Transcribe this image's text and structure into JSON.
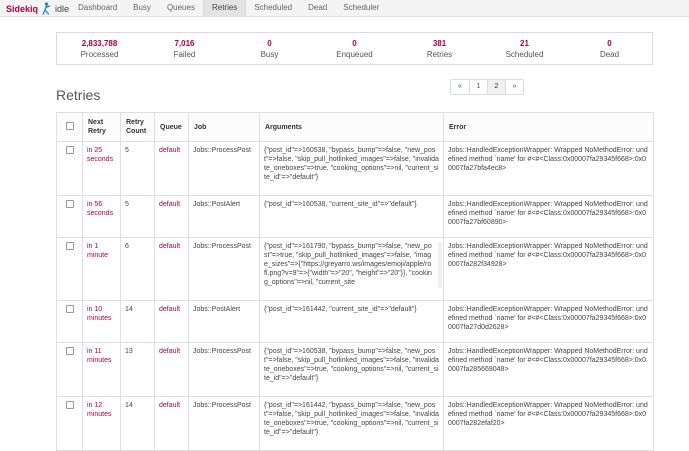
{
  "brand": {
    "name": "Sidekiq",
    "status": "idle"
  },
  "nav": [
    {
      "label": "Dashboard",
      "active": false
    },
    {
      "label": "Busy",
      "active": false
    },
    {
      "label": "Queues",
      "active": false
    },
    {
      "label": "Retries",
      "active": true
    },
    {
      "label": "Scheduled",
      "active": false
    },
    {
      "label": "Dead",
      "active": false
    },
    {
      "label": "Scheduler",
      "active": false
    }
  ],
  "stats": [
    {
      "value": "2,833,788",
      "label": "Processed"
    },
    {
      "value": "7,016",
      "label": "Failed"
    },
    {
      "value": "0",
      "label": "Busy"
    },
    {
      "value": "0",
      "label": "Enqueued"
    },
    {
      "value": "381",
      "label": "Retries"
    },
    {
      "value": "21",
      "label": "Scheduled"
    },
    {
      "value": "0",
      "label": "Dead"
    }
  ],
  "page_title": "Retries",
  "pagination": {
    "prev": "«",
    "pages": [
      "1",
      "2"
    ],
    "next": "»",
    "current": "2"
  },
  "table": {
    "headers": {
      "next_retry": "Next Retry",
      "retry_count": "Retry Count",
      "queue": "Queue",
      "job": "Job",
      "arguments": "Arguments",
      "error": "Error"
    },
    "rows": [
      {
        "when": "in 25 seconds",
        "count": "5",
        "queue": "default",
        "job": "Jobs::ProcessPost",
        "args": "{\"post_id\"=>160538, \"bypass_bump\"=>false, \"new_post\"=>false, \"skip_pull_hotlinked_images\"=>false, \"invalidate_oneboxes\"=>true, \"cooking_options\"=>nil, \"current_site_id\"=>\"default\"}",
        "error": "Jobs::HandledExceptionWrapper: Wrapped NoMethodError: undefined method `name' for #<#<Class:0x00007fa29345f668>:0x00007fa27bfa4ec8>"
      },
      {
        "when": "in 56 seconds",
        "count": "5",
        "queue": "default",
        "job": "Jobs::PostAlert",
        "args": "{\"post_id\"=>160538, \"current_site_id\"=>\"default\"}",
        "error": "Jobs::HandledExceptionWrapper: Wrapped NoMethodError: undefined method `name' for #<#<Class:0x00007fa29345f668>:0x00007fa27bf60890>"
      },
      {
        "when": "in 1 minute",
        "count": "6",
        "queue": "default",
        "job": "Jobs::ProcessPost",
        "args": "{\"post_id\"=>161790, \"bypass_bump\"=>false, \"new_post\"=>true, \"skip_pull_hotlinked_images\"=>false, \"image_sizes\"=>{\"https://greyarro.ws/images/emoji/apple/rofl.png?v=9\"=>{\"width\"=>\"20\", \"height\"=>\"20\"}}, \"cooking_options\"=>nil, \"current_site",
        "error": "Jobs::HandledExceptionWrapper: Wrapped NoMethodError: undefined method `name' for #<#<Class:0x00007fa29345f668>:0x00007fa282f34928>"
      },
      {
        "when": "in 10 minutes",
        "count": "14",
        "queue": "default",
        "job": "Jobs::PostAlert",
        "args": "{\"post_id\"=>161442, \"current_site_id\"=>\"default\"}",
        "error": "Jobs::HandledExceptionWrapper: Wrapped NoMethodError: undefined method `name' for #<#<Class:0x00007fa29345f668>:0x00007fa27d0d2628>"
      },
      {
        "when": "in 11 minutes",
        "count": "13",
        "queue": "default",
        "job": "Jobs::ProcessPost",
        "args": "{\"post_id\"=>160538, \"bypass_bump\"=>false, \"new_post\"=>false, \"skip_pull_hotlinked_images\"=>false, \"invalidate_oneboxes\"=>true, \"cooking_options\"=>nil, \"current_site_id\"=>\"default\"}",
        "error": "Jobs::HandledExceptionWrapper: Wrapped NoMethodError: undefined method `name' for #<#<Class:0x00007fa29345f668>:0x00007fa285669048>"
      },
      {
        "when": "in 12 minutes",
        "count": "14",
        "queue": "default",
        "job": "Jobs::ProcessPost",
        "args": "{\"post_id\"=>161442, \"bypass_bump\"=>false, \"new_post\"=>false, \"skip_pull_hotlinked_images\"=>false, \"invalidate_oneboxes\"=>true, \"cooking_options\"=>nil, \"current_site_id\"=>\"default\"}",
        "error": "Jobs::HandledExceptionWrapper: Wrapped NoMethodError: undefined method `name' for #<#<Class:0x00007fa29345f668>:0x00007fa282efaf20>"
      }
    ]
  },
  "colors": {
    "brand": "#b1003e",
    "link": "#1a5e9c"
  }
}
